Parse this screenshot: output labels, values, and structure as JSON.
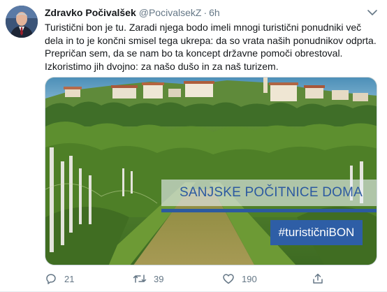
{
  "author": {
    "name": "Zdravko Počivalšek",
    "handle": "@PocivalsekZ",
    "separator": "·",
    "time": "6h"
  },
  "tweet_text": [
    "Turistični bon je tu. Zaradi njega bodo imeli mnogi turistični ponudniki več",
    "dela in to je končni smisel tega ukrepa: da so vrata naših ponudnikov odprta.",
    "Prepričan sem, da se nam bo ta koncept državne pomoči obrestoval.",
    "Izkoristimo jih dvojno: za našo dušo in za naš turizem."
  ],
  "media": {
    "overlay_title": "SANJSKE POČITNICE DOMA",
    "hashtag": "#turističniBON",
    "accent_color": "#2c5aa0"
  },
  "actions": {
    "reply_count": "21",
    "retweet_count": "39",
    "like_count": "190"
  },
  "icons": [
    "more-icon",
    "reply-icon",
    "retweet-icon",
    "like-icon",
    "share-icon"
  ]
}
